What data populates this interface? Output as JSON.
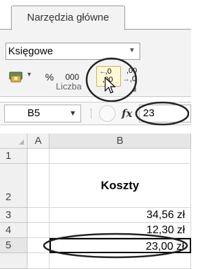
{
  "ribbon": {
    "tab_label": "Narzędzia główne",
    "number_format": "Księgowe",
    "percent_label": "%",
    "thousands_label": "000",
    "increase_decimal_label": ",00",
    "decrease_decimal_label": ",00",
    "group_label": "Liczba"
  },
  "formula_bar": {
    "name_box": "B5",
    "fx_label": "fx",
    "value": "23"
  },
  "sheet": {
    "col_a": "A",
    "col_b": "B",
    "rows": [
      {
        "num": "1",
        "b": ""
      },
      {
        "num": "2",
        "b": "Koszty"
      },
      {
        "num": "3",
        "b": "34,56 zł"
      },
      {
        "num": "4",
        "b": "12,30 zł"
      },
      {
        "num": "5",
        "b": "23,00 zł"
      }
    ]
  }
}
